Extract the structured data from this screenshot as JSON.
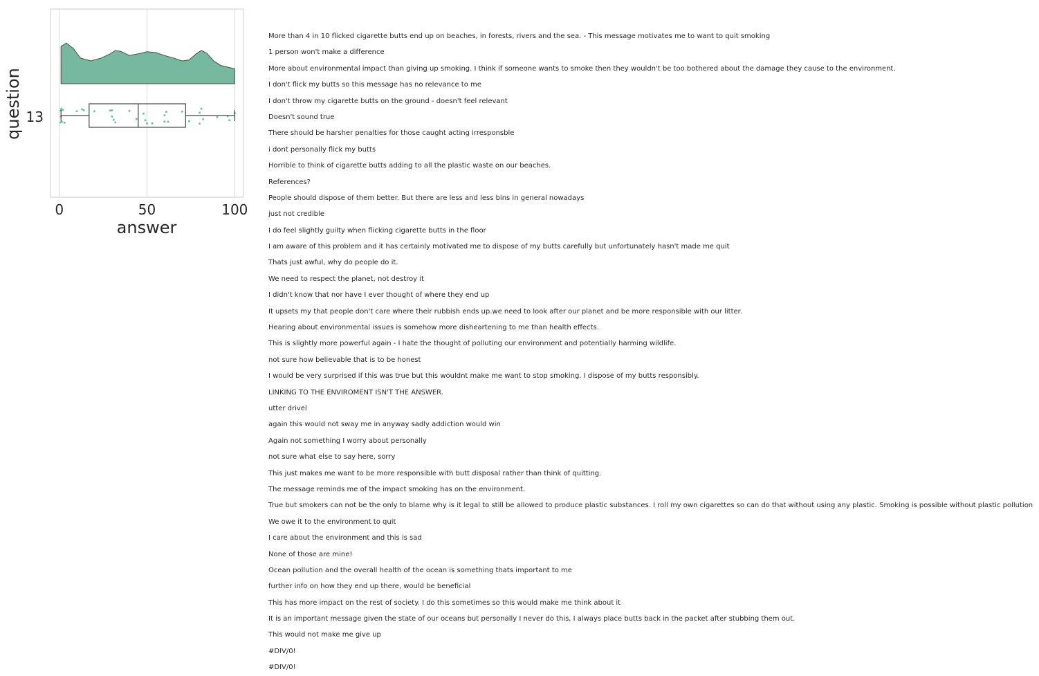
{
  "chart_data": {
    "type": "raincloud",
    "xlabel": "answer",
    "ylabel": "question",
    "category": "13",
    "xlim": [
      -5,
      105
    ],
    "xticks": [
      0,
      50,
      100
    ],
    "grid": true,
    "colors": {
      "fill": "#77b8a1",
      "point": "#66c2a5",
      "box_edge": "#444444"
    },
    "box": {
      "whisker_low": 1,
      "q1": 17,
      "median": 45,
      "q3": 72,
      "whisker_high": 100
    },
    "density": [
      [
        1,
        0.9
      ],
      [
        4,
        0.98
      ],
      [
        8,
        0.85
      ],
      [
        12,
        0.62
      ],
      [
        18,
        0.55
      ],
      [
        24,
        0.62
      ],
      [
        29,
        0.72
      ],
      [
        32,
        0.8
      ],
      [
        35,
        0.78
      ],
      [
        40,
        0.68
      ],
      [
        45,
        0.72
      ],
      [
        50,
        0.77
      ],
      [
        55,
        0.75
      ],
      [
        60,
        0.68
      ],
      [
        65,
        0.62
      ],
      [
        70,
        0.55
      ],
      [
        74,
        0.57
      ],
      [
        78,
        0.72
      ],
      [
        81,
        0.8
      ],
      [
        84,
        0.74
      ],
      [
        88,
        0.55
      ],
      [
        92,
        0.44
      ],
      [
        96,
        0.4
      ],
      [
        100,
        0.36
      ]
    ],
    "points": [
      [
        0.7,
        0.55
      ],
      [
        0.9,
        0.08
      ],
      [
        1.5,
        0.5
      ],
      [
        3.0,
        0.58
      ],
      [
        0.8,
        -0.4
      ],
      [
        1.2,
        -0.55
      ],
      [
        2.0,
        -0.45
      ],
      [
        10,
        -0.35
      ],
      [
        13,
        -0.5
      ],
      [
        14,
        -0.42
      ],
      [
        20,
        -0.35
      ],
      [
        29,
        -0.4
      ],
      [
        30,
        -0.42
      ],
      [
        30,
        0.08
      ],
      [
        31,
        0.35
      ],
      [
        32,
        0.55
      ],
      [
        40,
        -0.38
      ],
      [
        44,
        0.28
      ],
      [
        48,
        -0.15
      ],
      [
        49,
        0.38
      ],
      [
        50,
        0.63
      ],
      [
        53,
        0.63
      ],
      [
        60,
        0.48
      ],
      [
        60,
        -0.02
      ],
      [
        61,
        -0.3
      ],
      [
        62,
        0.5
      ],
      [
        70,
        -0.32
      ],
      [
        74,
        0.45
      ],
      [
        80,
        0.65
      ],
      [
        80,
        -0.22
      ],
      [
        81,
        -0.55
      ],
      [
        82,
        0.3
      ],
      [
        90,
        0.12
      ],
      [
        96,
        0.05
      ],
      [
        97,
        0.38
      ],
      [
        100,
        -0.18
      ]
    ]
  },
  "comments": [
    "More than 4 in 10 flicked cigarette butts end up on beaches, in forests, rivers and the sea. - This message motivates me to want to quit smoking",
    "1 person won't make a difference",
    "More about environmental impact than giving up smoking. I think if someone wants to smoke then they wouldn't be too bothered about the damage they cause to the environment.",
    "I don't flick my butts so this message has no relevance to me",
    "I don't throw my cigarette butts on the ground - doesn't feel relevant",
    "Doesn't sound true",
    "There should be harsher penalties for those caught acting irresponsble",
    "i dont personally flick my butts",
    "Horrible to think of cigarette butts adding to all the plastic waste on our beaches.",
    "References?",
    "People should dispose of them better. But there are less and less bins in general nowadays",
    "just not credible",
    "I do feel slightly guilty when flicking cigarette butts in the floor",
    "I am aware of this problem and it has certainly motivated me to dispose of my butts carefully but unfortunately hasn't made me quit",
    "Thats just awful, why do people do it.",
    "We need to respect the planet, not destroy it",
    "I didn't know that nor have I ever thought of where they end up",
    "It upsets my that people don't care where their rubbish ends up.we need to look after our planet and be more responsible with our litter.",
    "Hearing about environmental issues is somehow more disheartening to me than health effects.",
    "This is slightly more powerful again - I hate the thought of polluting our environment and potentially harming wildlife.",
    "not sure how believable that is to be honest",
    "I would be very surprised if this was true but this wouldnt make me want to stop smoking. I dispose of my butts responsibly.",
    "LINKING TO THE ENVIROMENT ISN'T THE ANSWER.",
    "utter drivel",
    "again this would not sway me in anyway sadly addiction would win",
    "Again not something I worry about personally",
    "not sure what else to say here, sorry",
    "This just makes me want to be more responsible with butt disposal rather than think of quitting.",
    "The message reminds me of the impact smoking has on the environment.",
    "True but smokers can not be the only to blame why is it legal to still be allowed to produce plastic substances. I roll my own cigarettes so can do that without using any plastic. Smoking is possible without plastic pollution",
    "We owe it to the environment to quit",
    "I care about the environment and this is sad",
    "None of those are mine!",
    "Ocean pollution and the overall health of the ocean is something thats important to me",
    "further info on how they end up there, would be beneficial",
    "This has more impact on the rest of society. I do this sometimes so this would make me think about it",
    "It is an important message given the state of our oceans but personally I never do this, I always place butts back in the packet after stubbing them out.",
    "This would not make me give up",
    "#DIV/0!",
    "#DIV/0!"
  ]
}
